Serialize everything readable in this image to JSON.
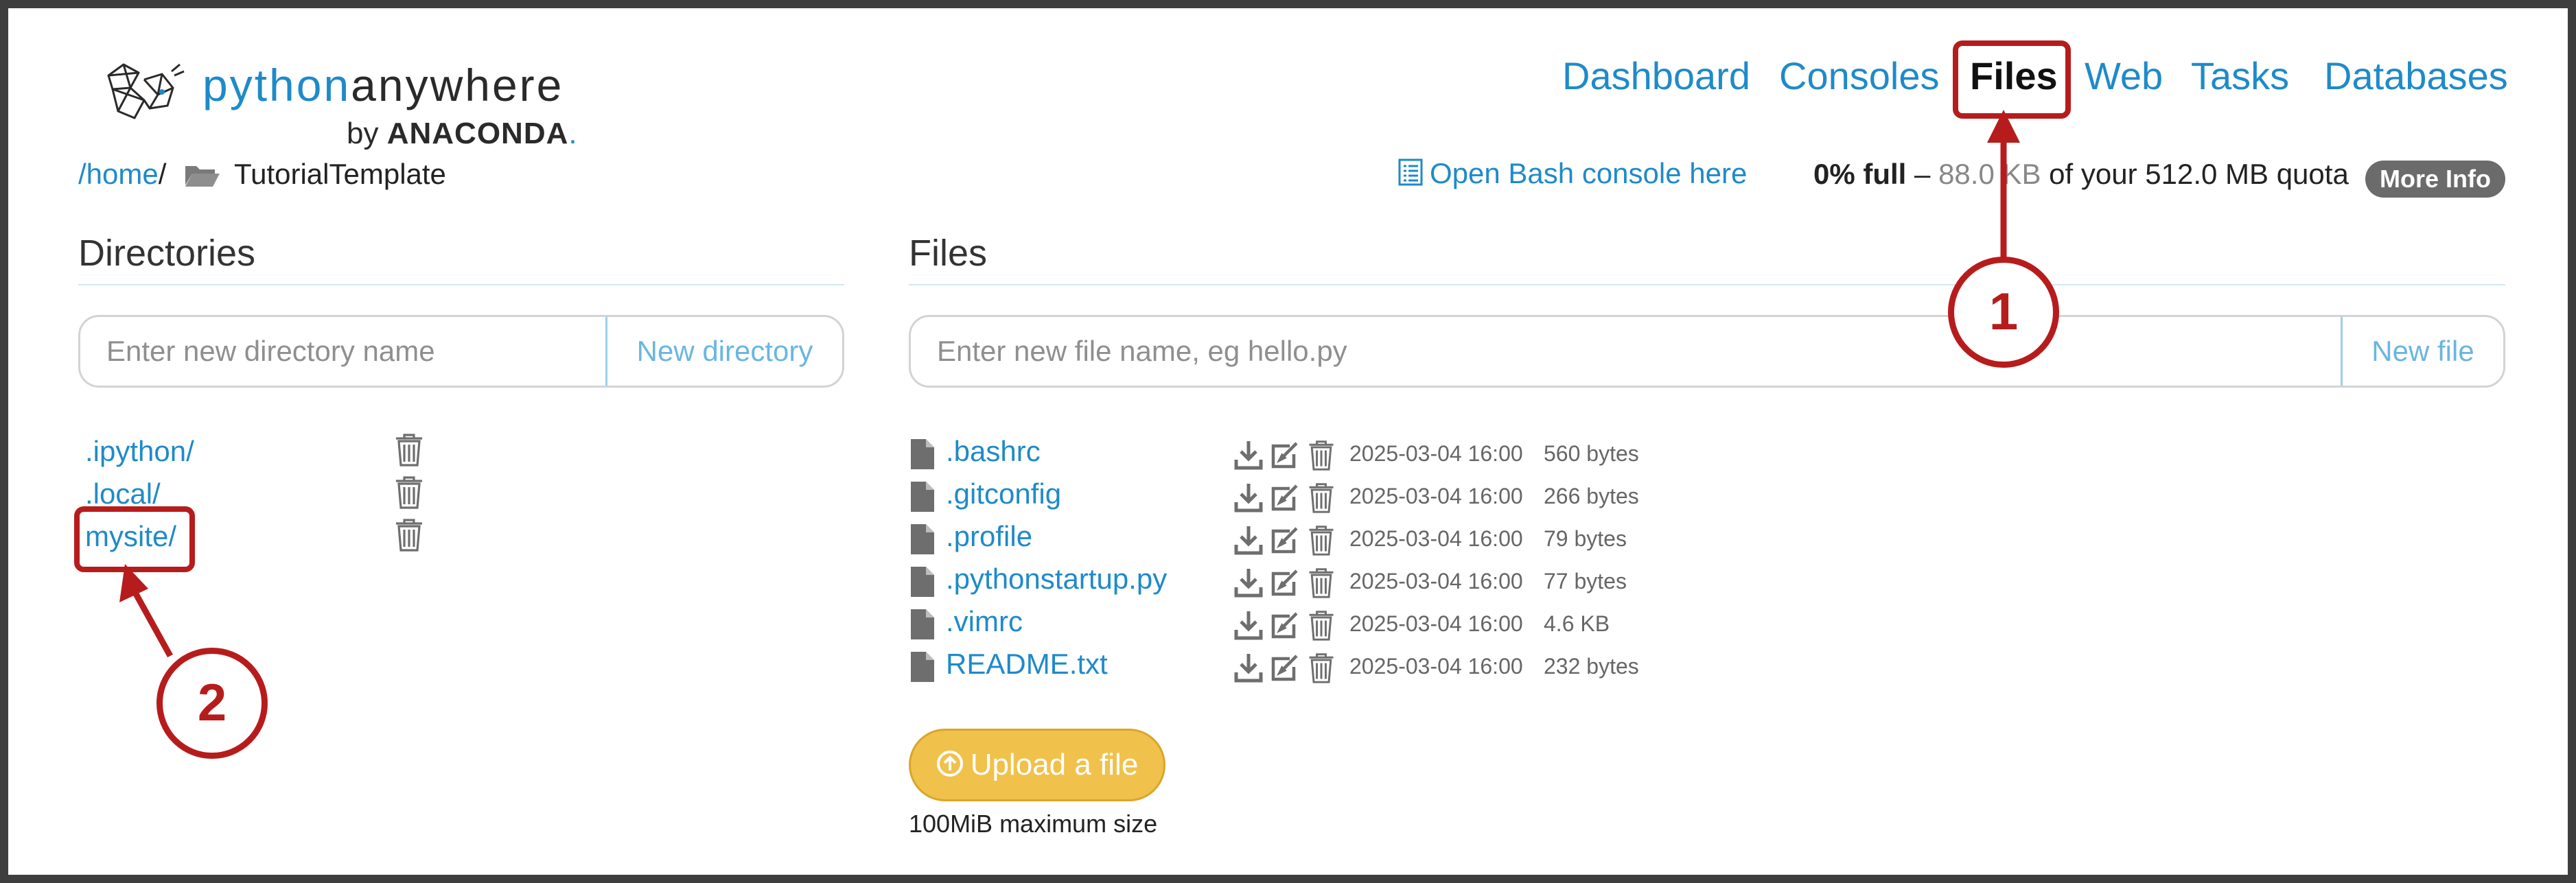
{
  "brand": {
    "name_part1": "python",
    "name_part2": "anywhere",
    "by_label": "by",
    "company": "ANACONDA",
    "company_dot": "."
  },
  "nav": {
    "items": [
      {
        "label": "Dashboard"
      },
      {
        "label": "Consoles"
      },
      {
        "label": "Files",
        "active": true
      },
      {
        "label": "Web"
      },
      {
        "label": "Tasks"
      },
      {
        "label": "Databases"
      }
    ]
  },
  "breadcrumb": {
    "root_link": "/home",
    "sep": "/",
    "current": "TutorialTemplate"
  },
  "header_actions": {
    "bash_link": "Open Bash console here",
    "quota_percent": "0% full",
    "quota_dash": " – ",
    "quota_used": "88.0 KB",
    "quota_rest": " of your 512.0 MB quota",
    "more_info": "More Info"
  },
  "directories": {
    "title": "Directories",
    "input_placeholder": "Enter new directory name",
    "button": "New directory",
    "items": [
      {
        "name": ".ipython/"
      },
      {
        "name": ".local/"
      },
      {
        "name": "mysite/"
      }
    ]
  },
  "files": {
    "title": "Files",
    "input_placeholder": "Enter new file name, eg hello.py",
    "button": "New file",
    "items": [
      {
        "name": ".bashrc",
        "date": "2025-03-04 16:00",
        "size": "560 bytes"
      },
      {
        "name": ".gitconfig",
        "date": "2025-03-04 16:00",
        "size": "266 bytes"
      },
      {
        "name": ".profile",
        "date": "2025-03-04 16:00",
        "size": "79 bytes"
      },
      {
        "name": ".pythonstartup.py",
        "date": "2025-03-04 16:00",
        "size": "77 bytes"
      },
      {
        "name": ".vimrc",
        "date": "2025-03-04 16:00",
        "size": "4.6 KB"
      },
      {
        "name": "README.txt",
        "date": "2025-03-04 16:00",
        "size": "232 bytes"
      }
    ],
    "upload_button": "Upload a file",
    "upload_note": "100MiB maximum size"
  },
  "annotations": {
    "callout_1": "1",
    "callout_2": "2",
    "color": "#b71c1c"
  },
  "colors": {
    "link": "#1f8ac9",
    "upload_bg": "#f0c14b",
    "badge_bg": "#6b6b6b"
  }
}
